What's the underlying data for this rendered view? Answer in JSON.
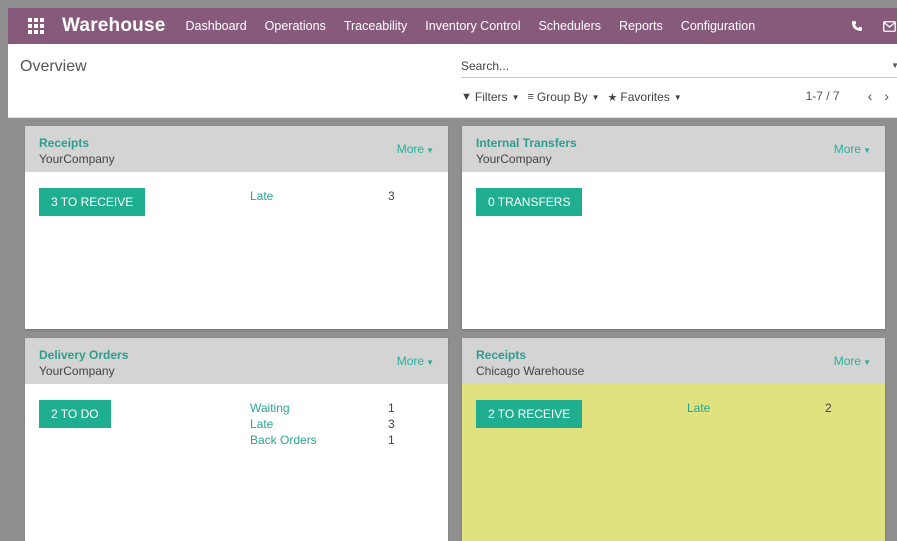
{
  "app": {
    "brand": "Warehouse",
    "menu": [
      "Dashboard",
      "Operations",
      "Traceability",
      "Inventory Control",
      "Schedulers",
      "Reports",
      "Configuration"
    ],
    "nav_icons": [
      "phone-icon",
      "mail-icon"
    ]
  },
  "control": {
    "breadcrumb": "Overview",
    "search_placeholder": "Search...",
    "filters_label": "Filters",
    "group_by_label": "Group By",
    "favorites_label": "Favorites",
    "pager": "1-7 / 7"
  },
  "cards": [
    {
      "title": "Receipts",
      "company": "YourCompany",
      "more": "More",
      "action": "3 TO RECEIVE",
      "stats": [
        {
          "label": "Late",
          "value": "3"
        }
      ]
    },
    {
      "title": "Internal Transfers",
      "company": "YourCompany",
      "more": "More",
      "action": "0 TRANSFERS",
      "stats": []
    },
    {
      "title": "Delivery Orders",
      "company": "YourCompany",
      "more": "More",
      "action": "2 TO DO",
      "stats": [
        {
          "label": "Waiting",
          "value": "1"
        },
        {
          "label": "Late",
          "value": "3"
        },
        {
          "label": "Back Orders",
          "value": "1"
        }
      ]
    },
    {
      "title": "Receipts",
      "company": "Chicago Warehouse",
      "more": "More",
      "action": "2 TO RECEIVE",
      "stats": [
        {
          "label": "Late",
          "value": "2"
        }
      ],
      "color": "#dfe27e"
    }
  ],
  "colors": {
    "navbar": "#875a7b",
    "accent": "#1fae8f",
    "link": "#2c9e8e"
  }
}
